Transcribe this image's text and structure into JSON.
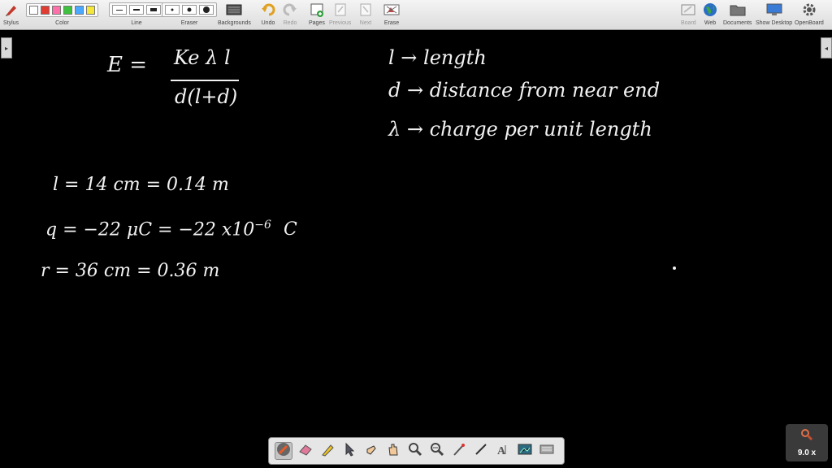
{
  "toolbar": {
    "stylus_label": "Stylus",
    "color_label": "Color",
    "line_label": "Line",
    "eraser_label": "Eraser",
    "backgrounds_label": "Backgrounds",
    "undo_label": "Undo",
    "redo_label": "Redo",
    "pages_label": "Pages",
    "previous_label": "Previous",
    "next_label": "Next",
    "erase_label": "Erase",
    "board_label": "Board",
    "web_label": "Web",
    "documents_label": "Documents",
    "show_desktop_label": "Show Desktop",
    "openboard_label": "OpenBoard",
    "colors": [
      "#ffffff",
      "#e03c31",
      "#ff6fa8",
      "#3ec23e",
      "#4aa8ff",
      "#f5e63a"
    ]
  },
  "board": {
    "formula_numerator": "Ke λ l",
    "formula_lhs": "E  =",
    "formula_denominator": "d(l+d)",
    "legend_l": "l → length",
    "legend_d": "d → distance from near end",
    "legend_lambda": "λ → charge per unit length",
    "given_l": "l = 14 cm  = 0.14 m",
    "given_q_main": "q =  −22 μC    =   −22 x10",
    "given_q_exp": "−6",
    "given_q_unit": "C",
    "given_r": "r =  36 cm    =   0.36 m"
  },
  "zoom": {
    "value": "9.0 x"
  }
}
